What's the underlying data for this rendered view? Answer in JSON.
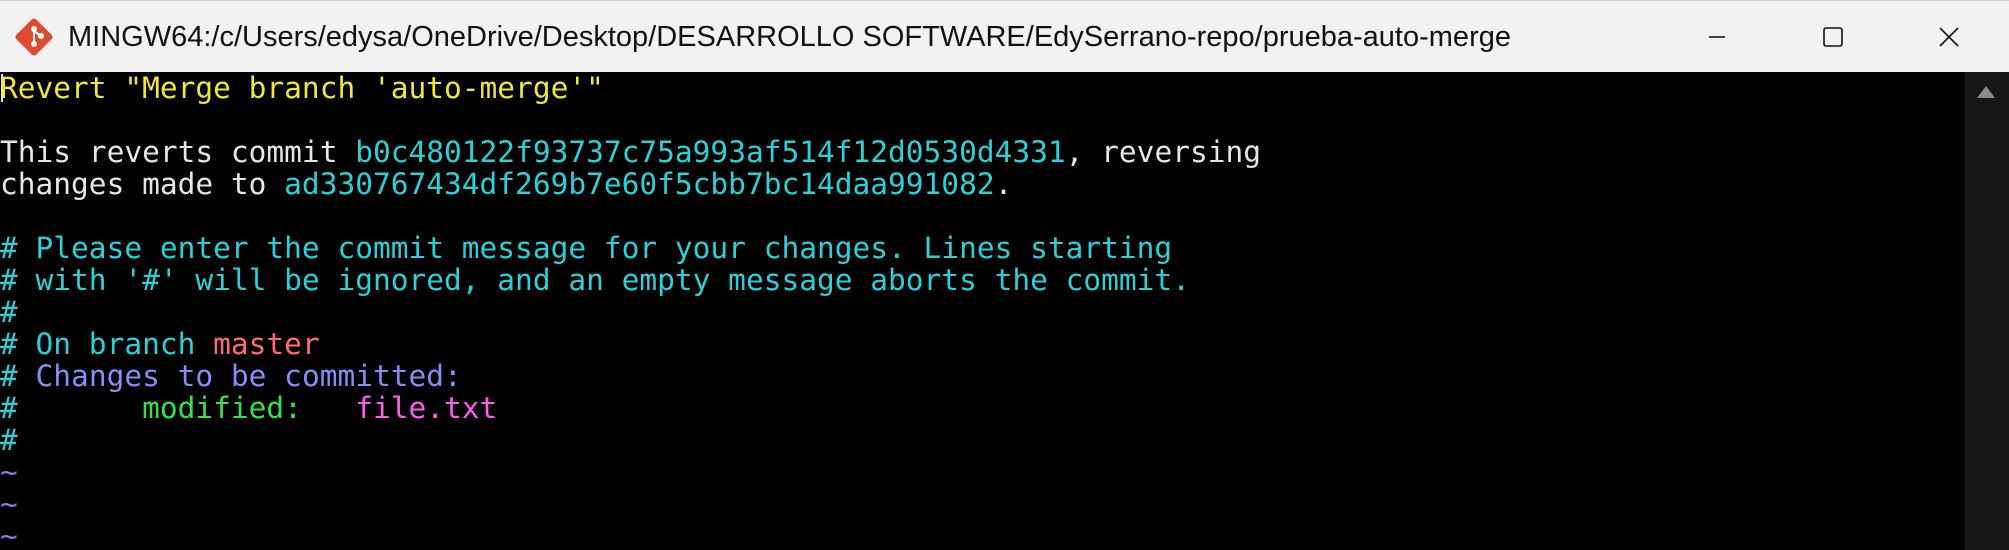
{
  "window": {
    "title": "MINGW64:/c/Users/edysa/OneDrive/Desktop/DESARROLLO SOFTWARE/EdySerrano-repo/prueba-auto-merge",
    "icon": "git-bash-icon",
    "controls": {
      "minimize": "minimize-icon",
      "maximize": "maximize-icon",
      "close": "close-icon"
    }
  },
  "terminal": {
    "line1": "Revert \"Merge branch 'auto-merge'\"",
    "line3": {
      "prefix": "This reverts commit ",
      "commit": "b0c480122f93737c75a993af514f12d0530d4331",
      "suffix": ", reversing"
    },
    "line4": {
      "prefix": "changes made to ",
      "commit": "ad330767434df269b7e60f5cbb7bc14daa991082",
      "suffix": "."
    },
    "line6": "# Please enter the commit message for your changes. Lines starting",
    "line7": "# with '#' will be ignored, and an empty message aborts the commit.",
    "line8": "#",
    "line9": {
      "prefix": "# On branch ",
      "branch": "master"
    },
    "line10": {
      "hash": "# ",
      "text": "Changes to be committed:"
    },
    "line11": {
      "hash": "#",
      "status": "       modified:   ",
      "file": "file.txt"
    },
    "line12": "#",
    "tilde": "~"
  },
  "colors": {
    "background": "#000000",
    "title_bar": "#f2f2f2",
    "yellow": "#f0e63c",
    "cyan": "#2ad1d8",
    "blue": "#8a8cf5",
    "red": "#ff6e6e",
    "green": "#33e34a",
    "magenta": "#ff5cf0"
  }
}
